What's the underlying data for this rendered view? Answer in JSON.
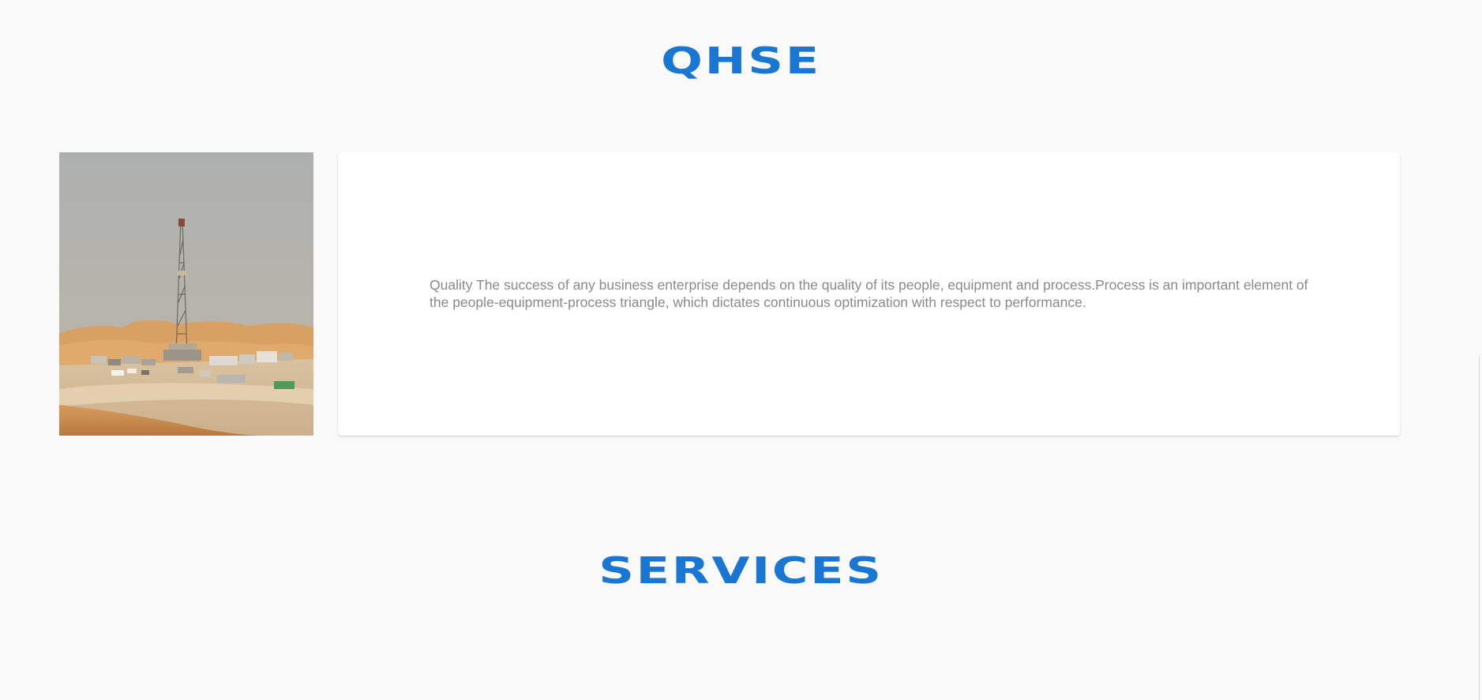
{
  "sections": {
    "qhse": {
      "title": "QHSE",
      "image_alt": "Drilling rig in desert",
      "description": "Quality The success of any business enterprise depends on the quality of its people, equipment and process.Process is an important element of the people-equipment-process triangle, which dictates continuous optimization with respect to performance."
    },
    "services": {
      "title": "SERVICES"
    }
  },
  "colors": {
    "background": "#f9f9f9",
    "heading": "#1976d2",
    "card": "#ffffff",
    "body_text": "#8a8a8a"
  }
}
